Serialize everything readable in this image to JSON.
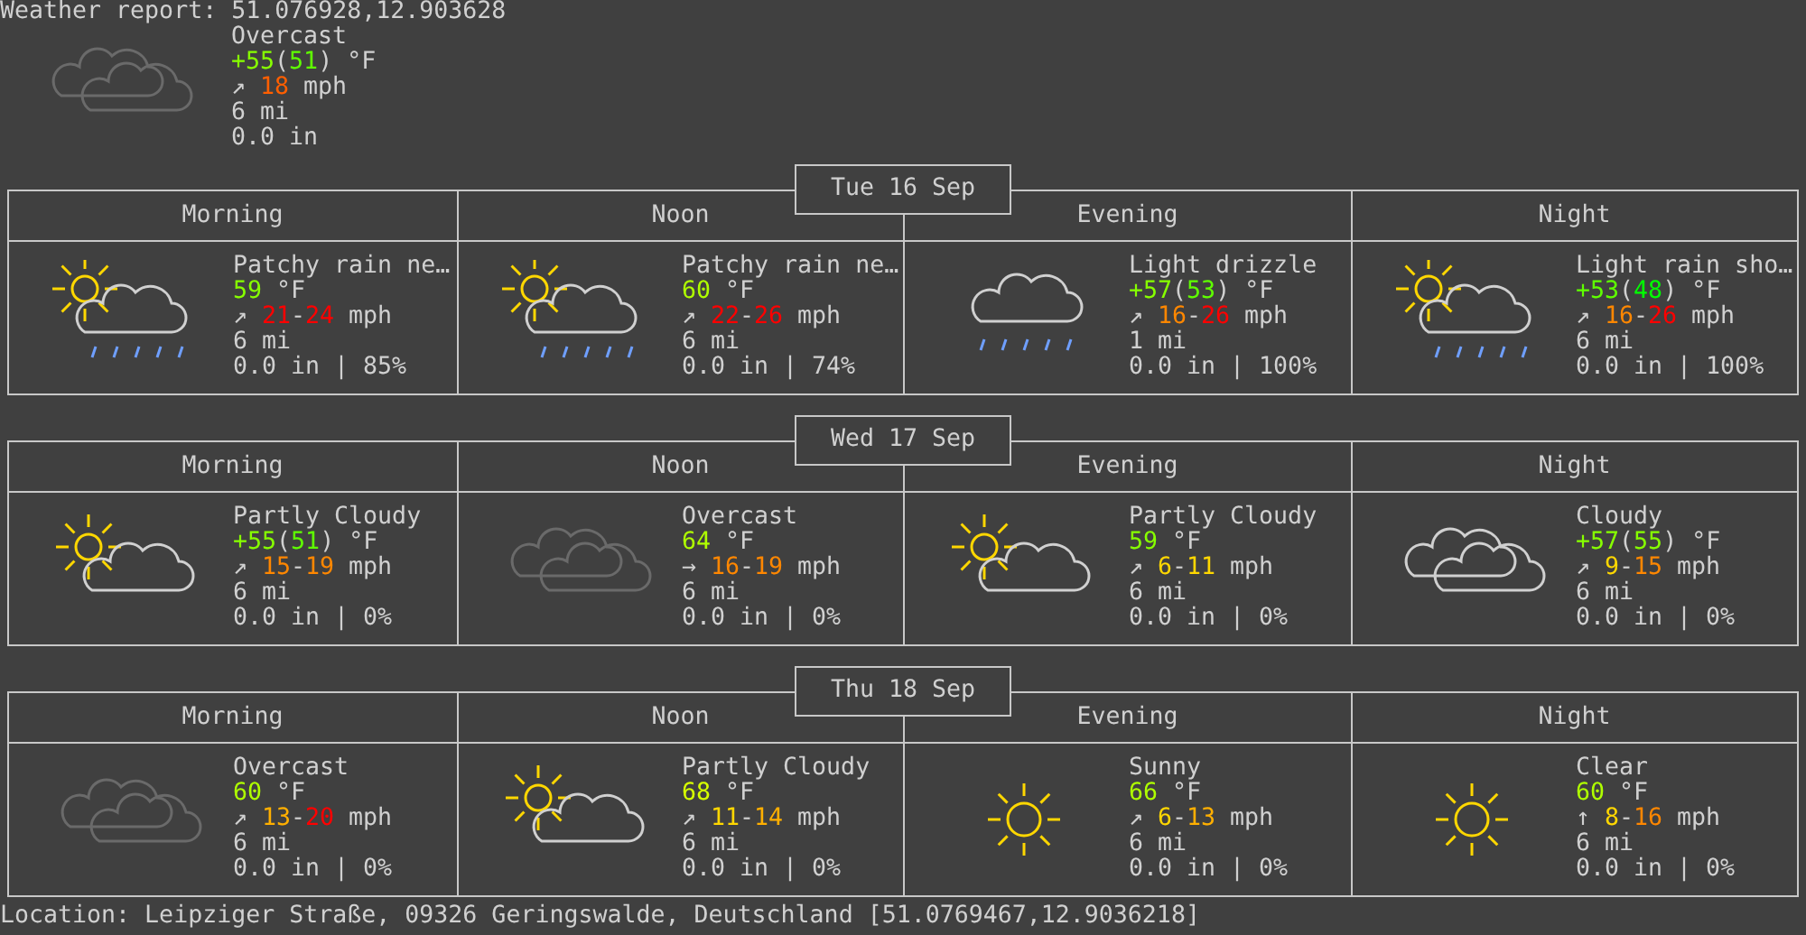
{
  "title": "Weather report: 51.076928,12.903628",
  "current": {
    "kind": "overcast",
    "condition": "Overcast",
    "temp": [
      {
        "text": "+55",
        "color": "#87ff00"
      },
      {
        "text": "("
      },
      {
        "text": "51",
        "color": "#5fff00"
      },
      {
        "text": ")"
      }
    ],
    "temp_unit": "°F",
    "wind_arrow": "↗",
    "wind": [
      {
        "text": "18",
        "color": "#ff5f00"
      }
    ],
    "wind_unit": "mph",
    "visibility": "6 mi",
    "precip": "0.0 in"
  },
  "days": [
    {
      "date": "Tue 16 Sep",
      "periods": [
        {
          "label": "Morning",
          "kind": "sun_cloud_rain",
          "condition": "Patchy rain ne…",
          "temp": [
            {
              "text": "59",
              "color": "#87ff00"
            }
          ],
          "temp_unit": "°F",
          "wind_arrow": "↗",
          "wind": [
            {
              "text": "21",
              "color": "#ff0000"
            },
            {
              "text": "-"
            },
            {
              "text": "24",
              "color": "#ff0000"
            }
          ],
          "wind_unit": "mph",
          "visibility": "6 mi",
          "precip": "0.0 in | 85%"
        },
        {
          "label": "Noon",
          "kind": "sun_cloud_rain",
          "condition": "Patchy rain ne…",
          "temp": [
            {
              "text": "60",
              "color": "#afff00"
            }
          ],
          "temp_unit": "°F",
          "wind_arrow": "↗",
          "wind": [
            {
              "text": "22",
              "color": "#ff0000"
            },
            {
              "text": "-"
            },
            {
              "text": "26",
              "color": "#ff0000"
            }
          ],
          "wind_unit": "mph",
          "visibility": "6 mi",
          "precip": "0.0 in | 74%"
        },
        {
          "label": "Evening",
          "kind": "cloud_rain",
          "condition": "Light drizzle",
          "temp": [
            {
              "text": "+57",
              "color": "#87ff00"
            },
            {
              "text": "("
            },
            {
              "text": "53",
              "color": "#5fff00"
            },
            {
              "text": ")"
            }
          ],
          "temp_unit": "°F",
          "wind_arrow": "↗",
          "wind": [
            {
              "text": "16",
              "color": "#ff8700"
            },
            {
              "text": "-"
            },
            {
              "text": "26",
              "color": "#ff0000"
            }
          ],
          "wind_unit": "mph",
          "visibility": "1 mi",
          "precip": "0.0 in | 100%"
        },
        {
          "label": "Night",
          "kind": "sun_cloud_rain",
          "condition": "Light rain sho…",
          "temp": [
            {
              "text": "+53",
              "color": "#5fff00"
            },
            {
              "text": "("
            },
            {
              "text": "48",
              "color": "#00ff00"
            },
            {
              "text": ")"
            }
          ],
          "temp_unit": "°F",
          "wind_arrow": "↗",
          "wind": [
            {
              "text": "16",
              "color": "#ff8700"
            },
            {
              "text": "-"
            },
            {
              "text": "26",
              "color": "#ff0000"
            }
          ],
          "wind_unit": "mph",
          "visibility": "6 mi",
          "precip": "0.0 in | 100%"
        }
      ]
    },
    {
      "date": "Wed 17 Sep",
      "periods": [
        {
          "label": "Morning",
          "kind": "sun_cloud",
          "condition": "Partly Cloudy",
          "temp": [
            {
              "text": "+55",
              "color": "#87ff00"
            },
            {
              "text": "("
            },
            {
              "text": "51",
              "color": "#5fff00"
            },
            {
              "text": ")"
            }
          ],
          "temp_unit": "°F",
          "wind_arrow": "↗",
          "wind": [
            {
              "text": "15",
              "color": "#ff8700"
            },
            {
              "text": "-"
            },
            {
              "text": "19",
              "color": "#ff8700"
            }
          ],
          "wind_unit": "mph",
          "visibility": "6 mi",
          "precip": "0.0 in | 0%"
        },
        {
          "label": "Noon",
          "kind": "overcast",
          "condition": "Overcast",
          "temp": [
            {
              "text": "64",
              "color": "#afff00"
            }
          ],
          "temp_unit": "°F",
          "wind_arrow": "→",
          "wind": [
            {
              "text": "16",
              "color": "#ff8700"
            },
            {
              "text": "-"
            },
            {
              "text": "19",
              "color": "#ff8700"
            }
          ],
          "wind_unit": "mph",
          "visibility": "6 mi",
          "precip": "0.0 in | 0%"
        },
        {
          "label": "Evening",
          "kind": "sun_cloud",
          "condition": "Partly Cloudy",
          "temp": [
            {
              "text": "59",
              "color": "#87ff00"
            }
          ],
          "temp_unit": "°F",
          "wind_arrow": "↗",
          "wind": [
            {
              "text": "6",
              "color": "#ffd700"
            },
            {
              "text": "-"
            },
            {
              "text": "11",
              "color": "#ffd700"
            }
          ],
          "wind_unit": "mph",
          "visibility": "6 mi",
          "precip": "0.0 in | 0%"
        },
        {
          "label": "Night",
          "kind": "cloudy",
          "condition": "Cloudy",
          "temp": [
            {
              "text": "+57",
              "color": "#87ff00"
            },
            {
              "text": "("
            },
            {
              "text": "55",
              "color": "#87ff00"
            },
            {
              "text": ")"
            }
          ],
          "temp_unit": "°F",
          "wind_arrow": "↗",
          "wind": [
            {
              "text": "9",
              "color": "#ffd700"
            },
            {
              "text": "-"
            },
            {
              "text": "15",
              "color": "#ff8700"
            }
          ],
          "wind_unit": "mph",
          "visibility": "6 mi",
          "precip": "0.0 in | 0%"
        }
      ]
    },
    {
      "date": "Thu 18 Sep",
      "periods": [
        {
          "label": "Morning",
          "kind": "overcast",
          "condition": "Overcast",
          "temp": [
            {
              "text": "60",
              "color": "#afff00"
            }
          ],
          "temp_unit": "°F",
          "wind_arrow": "↗",
          "wind": [
            {
              "text": "13",
              "color": "#ffaf00"
            },
            {
              "text": "-"
            },
            {
              "text": "20",
              "color": "#ff0000"
            }
          ],
          "wind_unit": "mph",
          "visibility": "6 mi",
          "precip": "0.0 in | 0%"
        },
        {
          "label": "Noon",
          "kind": "sun_cloud",
          "condition": "Partly Cloudy",
          "temp": [
            {
              "text": "68",
              "color": "#d7ff00"
            }
          ],
          "temp_unit": "°F",
          "wind_arrow": "↗",
          "wind": [
            {
              "text": "11",
              "color": "#ffd700"
            },
            {
              "text": "-"
            },
            {
              "text": "14",
              "color": "#ffaf00"
            }
          ],
          "wind_unit": "mph",
          "visibility": "6 mi",
          "precip": "0.0 in | 0%"
        },
        {
          "label": "Evening",
          "kind": "sun",
          "condition": "Sunny",
          "temp": [
            {
              "text": "66",
              "color": "#afff00"
            }
          ],
          "temp_unit": "°F",
          "wind_arrow": "↗",
          "wind": [
            {
              "text": "6",
              "color": "#ffd700"
            },
            {
              "text": "-"
            },
            {
              "text": "13",
              "color": "#ffaf00"
            }
          ],
          "wind_unit": "mph",
          "visibility": "6 mi",
          "precip": "0.0 in | 0%"
        },
        {
          "label": "Night",
          "kind": "sun",
          "condition": "Clear",
          "temp": [
            {
              "text": "60",
              "color": "#afff00"
            }
          ],
          "temp_unit": "°F",
          "wind_arrow": "↑",
          "wind": [
            {
              "text": "8",
              "color": "#ffd700"
            },
            {
              "text": "-"
            },
            {
              "text": "16",
              "color": "#ff8700"
            }
          ],
          "wind_unit": "mph",
          "visibility": "6 mi",
          "precip": "0.0 in | 0%"
        }
      ]
    }
  ],
  "location": "Location: Leipziger Straße, 09326 Geringswalde, Deutschland [51.0769467,12.9036218]"
}
